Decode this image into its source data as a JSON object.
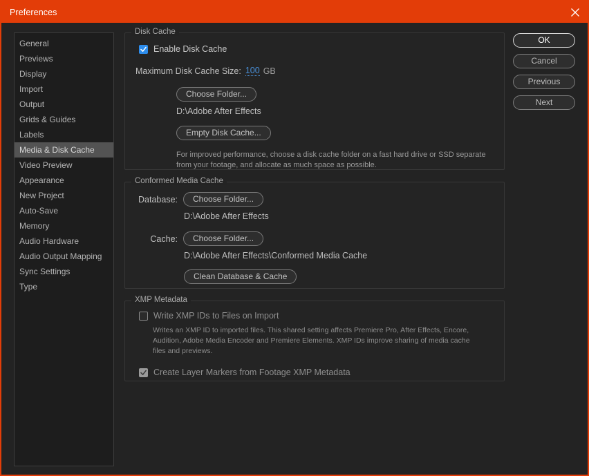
{
  "window": {
    "title": "Preferences",
    "close_icon": "close-icon",
    "accent_color": "#e33d08"
  },
  "sidebar": {
    "items": [
      {
        "label": "General",
        "selected": false
      },
      {
        "label": "Previews",
        "selected": false
      },
      {
        "label": "Display",
        "selected": false
      },
      {
        "label": "Import",
        "selected": false
      },
      {
        "label": "Output",
        "selected": false
      },
      {
        "label": "Grids & Guides",
        "selected": false
      },
      {
        "label": "Labels",
        "selected": false
      },
      {
        "label": "Media & Disk Cache",
        "selected": true
      },
      {
        "label": "Video Preview",
        "selected": false
      },
      {
        "label": "Appearance",
        "selected": false
      },
      {
        "label": "New Project",
        "selected": false
      },
      {
        "label": "Auto-Save",
        "selected": false
      },
      {
        "label": "Memory",
        "selected": false
      },
      {
        "label": "Audio Hardware",
        "selected": false
      },
      {
        "label": "Audio Output Mapping",
        "selected": false
      },
      {
        "label": "Sync Settings",
        "selected": false
      },
      {
        "label": "Type",
        "selected": false
      }
    ]
  },
  "disk_cache": {
    "group_label": "Disk Cache",
    "enable_label": "Enable Disk Cache",
    "enable_checked": true,
    "max_size_label": "Maximum Disk Cache Size:",
    "max_size_value": "100",
    "max_size_unit": "GB",
    "choose_folder_label": "Choose Folder...",
    "folder_path": "D:\\Adobe After Effects",
    "empty_cache_label": "Empty Disk Cache...",
    "help_text": "For improved performance, choose a disk cache folder on a fast hard drive or SSD separate from your footage, and allocate as much space as possible."
  },
  "conformed_media_cache": {
    "group_label": "Conformed Media Cache",
    "database_label": "Database:",
    "database_button": "Choose Folder...",
    "database_path": "D:\\Adobe After Effects",
    "cache_label": "Cache:",
    "cache_button": "Choose Folder...",
    "cache_path": "D:\\Adobe After Effects\\Conformed Media Cache",
    "clean_button": "Clean Database & Cache"
  },
  "xmp_metadata": {
    "group_label": "XMP Metadata",
    "write_ids_label": "Write XMP IDs to Files on Import",
    "write_ids_checked": false,
    "write_ids_help": "Writes an XMP ID to imported files. This shared setting affects Premiere Pro, After Effects, Encore, Audition, Adobe Media Encoder and Premiere Elements. XMP IDs improve sharing of media cache files and previews.",
    "layer_markers_label": "Create Layer Markers from Footage XMP Metadata",
    "layer_markers_checked": true
  },
  "actions": {
    "ok": "OK",
    "cancel": "Cancel",
    "previous": "Previous",
    "next": "Next"
  }
}
